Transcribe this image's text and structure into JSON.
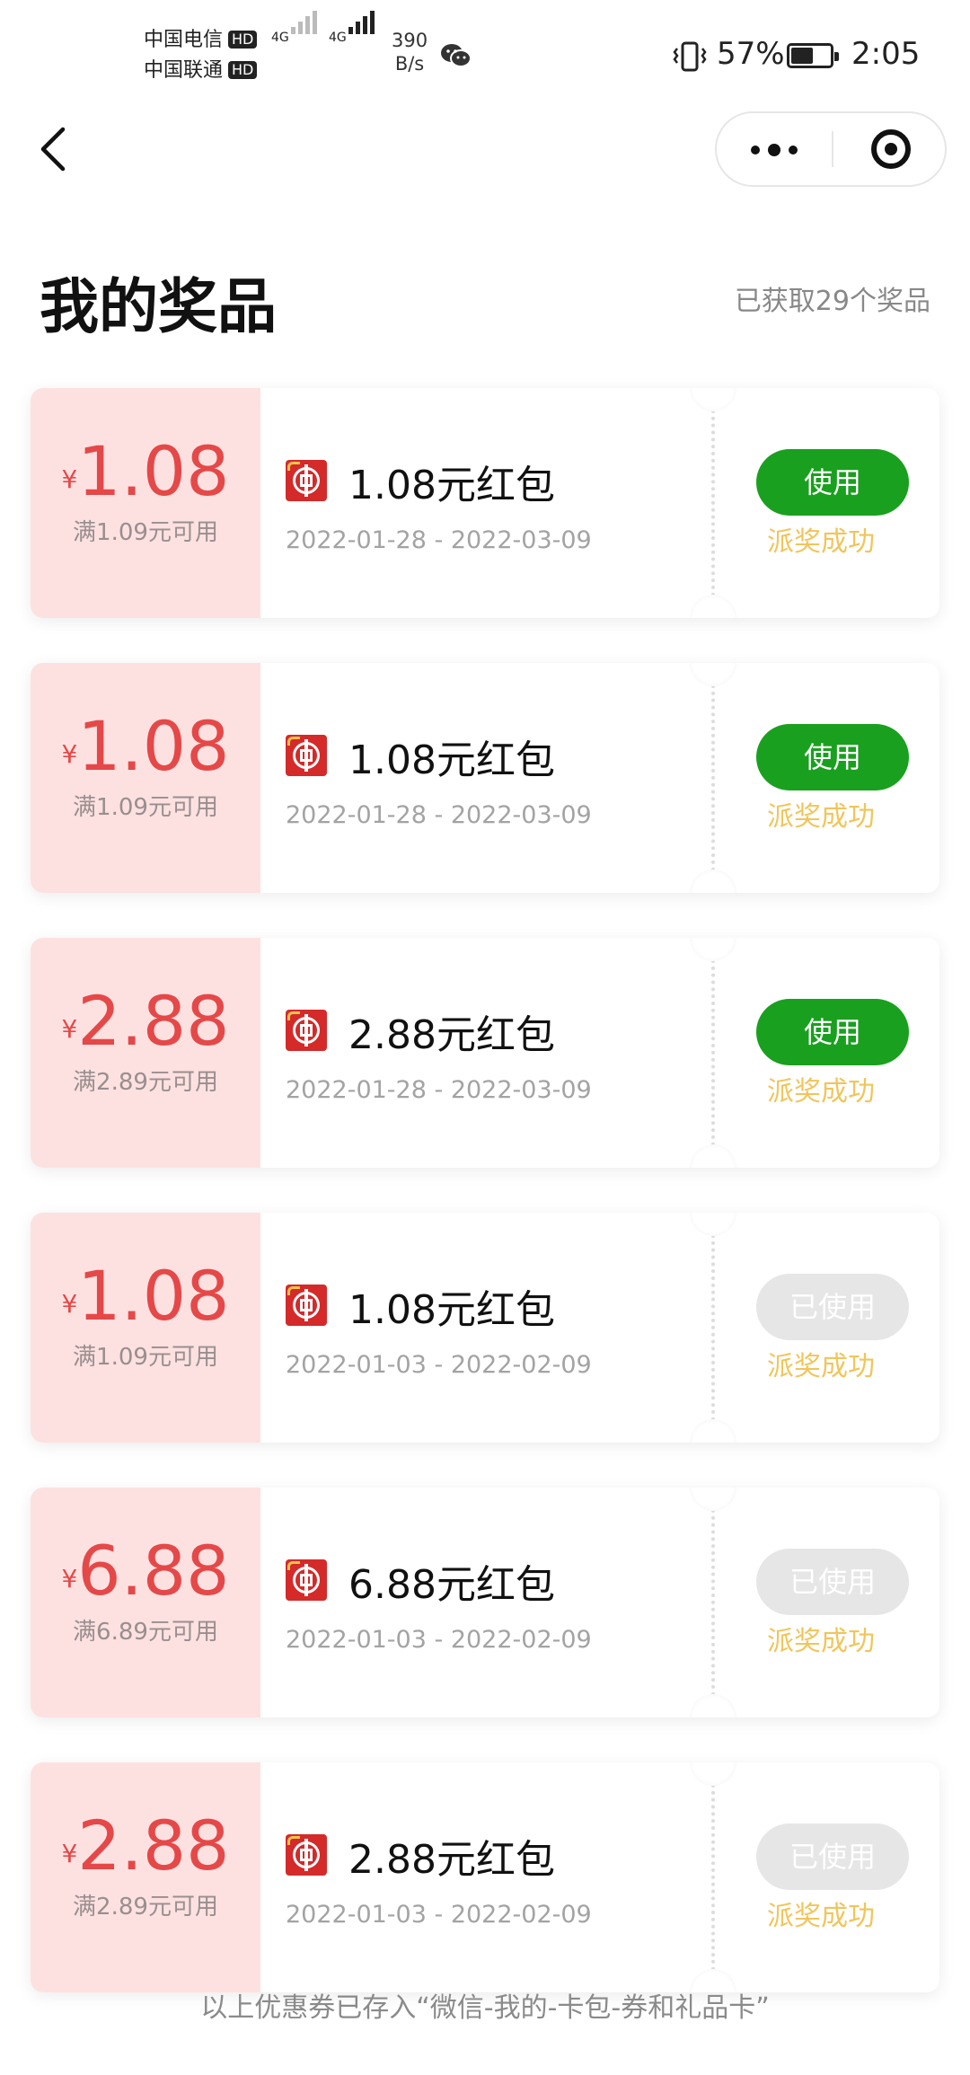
{
  "status_bar": {
    "carrier1": "中国电信",
    "carrier2": "中国联通",
    "hd": "HD",
    "net1": "4G",
    "net2": "4G",
    "speed_value": "390",
    "speed_unit": "B/s",
    "battery": "57%",
    "battery_level": 0.57,
    "time": "2:05"
  },
  "header": {
    "title": "我的奖品",
    "count_text": "已获取29个奖品"
  },
  "coupons": [
    {
      "currency": "¥",
      "amount": "1.08",
      "condition": "满1.09元可用",
      "name": "1.08元红包",
      "dates": "2022-01-28 - 2022-03-09",
      "button": "使用",
      "state": "use",
      "status": "派奖成功"
    },
    {
      "currency": "¥",
      "amount": "1.08",
      "condition": "满1.09元可用",
      "name": "1.08元红包",
      "dates": "2022-01-28 - 2022-03-09",
      "button": "使用",
      "state": "use",
      "status": "派奖成功"
    },
    {
      "currency": "¥",
      "amount": "2.88",
      "condition": "满2.89元可用",
      "name": "2.88元红包",
      "dates": "2022-01-28 - 2022-03-09",
      "button": "使用",
      "state": "use",
      "status": "派奖成功"
    },
    {
      "currency": "¥",
      "amount": "1.08",
      "condition": "满1.09元可用",
      "name": "1.08元红包",
      "dates": "2022-01-03 - 2022-02-09",
      "button": "已使用",
      "state": "used",
      "status": "派奖成功"
    },
    {
      "currency": "¥",
      "amount": "6.88",
      "condition": "满6.89元可用",
      "name": "6.88元红包",
      "dates": "2022-01-03 - 2022-02-09",
      "button": "已使用",
      "state": "used",
      "status": "派奖成功"
    },
    {
      "currency": "¥",
      "amount": "2.88",
      "condition": "满2.89元可用",
      "name": "2.88元红包",
      "dates": "2022-01-03 - 2022-02-09",
      "button": "已使用",
      "state": "used",
      "status": "派奖成功"
    }
  ],
  "footnote": "以上优惠券已存入“微信-我的-卡包-券和礼品卡”",
  "colors": {
    "accent_green": "#1aa01f",
    "price_red": "#e54848",
    "coupon_left_bg": "#fde1e1",
    "status_yellow": "#f1c55a"
  },
  "icons": [
    "back-chevron-icon",
    "more-dots-icon",
    "close-target-icon",
    "bank-logo-icon",
    "wechat-icon",
    "vibrate-icon",
    "battery-icon"
  ]
}
